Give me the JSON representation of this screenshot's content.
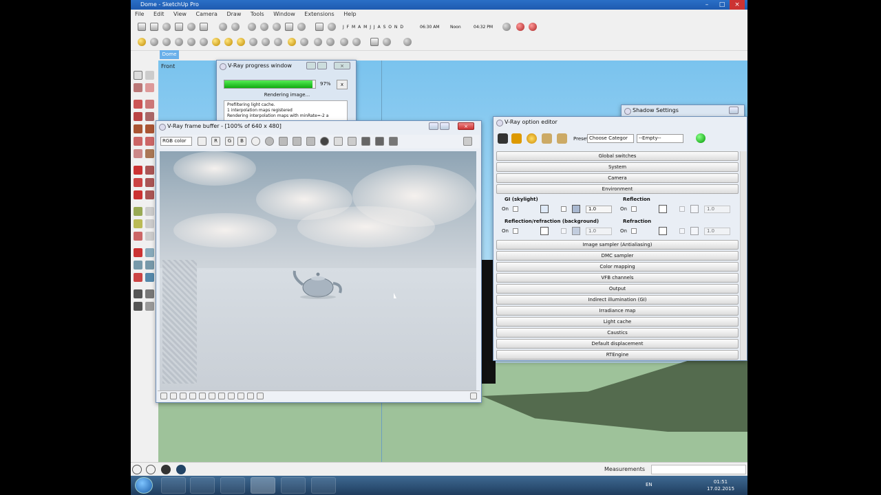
{
  "app": {
    "title": "Dome - SketchUp Pro",
    "menu": [
      "File",
      "Edit",
      "View",
      "Camera",
      "Draw",
      "Tools",
      "Window",
      "Extensions",
      "Help"
    ],
    "months": "J F M A M J J A S O N D",
    "time_start": "06:30 AM",
    "time_noon": "Noon",
    "time_end": "04:32 PM",
    "scene_tab": "Dome",
    "view_label": "Front",
    "measurements_label": "Measurements",
    "measurements_value": ""
  },
  "progress_window": {
    "title": "V-Ray progress window",
    "percent": "97%",
    "progress_fraction": 0.97,
    "status": "Rendering image...",
    "log": [
      "Prefiltering light cache.",
      "1 interpolation maps registered",
      "Rendering interpolation maps with minRate=-2 a"
    ]
  },
  "frame_buffer": {
    "title": "V-Ray frame buffer - [100% of 640 x 480]",
    "channel": "RGB color",
    "r": "R",
    "g": "G",
    "b": "B"
  },
  "option_editor": {
    "title": "V-Ray option editor",
    "presets_label": "Presets",
    "category": "Choose Categor",
    "preset": "--Empty--",
    "rollouts_top": [
      "Global switches",
      "System",
      "Camera",
      "Environment"
    ],
    "gi_label": "GI (skylight)",
    "reflection_label": "Reflection",
    "refl_refr_label": "Reflection/refraction (background)",
    "refraction_label": "Refraction",
    "on": "On",
    "gi_multiplier": "1.0",
    "refl_multiplier": "1.0",
    "rr_multiplier": "1.0",
    "refr_multiplier": "1.0",
    "rollouts_bottom": [
      "Image sampler (Antialiasing)",
      "DMC sampler",
      "Color mapping",
      "VFB channels",
      "Output",
      "Indirect illumination (GI)",
      "Irradiance map",
      "Light cache",
      "Caustics",
      "Default displacement",
      "RTEngine"
    ]
  },
  "shadow_settings": {
    "title": "Shadow Settings"
  },
  "taskbar": {
    "lang": "EN",
    "time": "01:51",
    "date": "17.02.2015"
  },
  "colors": {
    "titlebar": "#1e5bb0",
    "sky": "#7cc7f0",
    "ground": "#9ec29a",
    "progress": "#22aa22"
  }
}
